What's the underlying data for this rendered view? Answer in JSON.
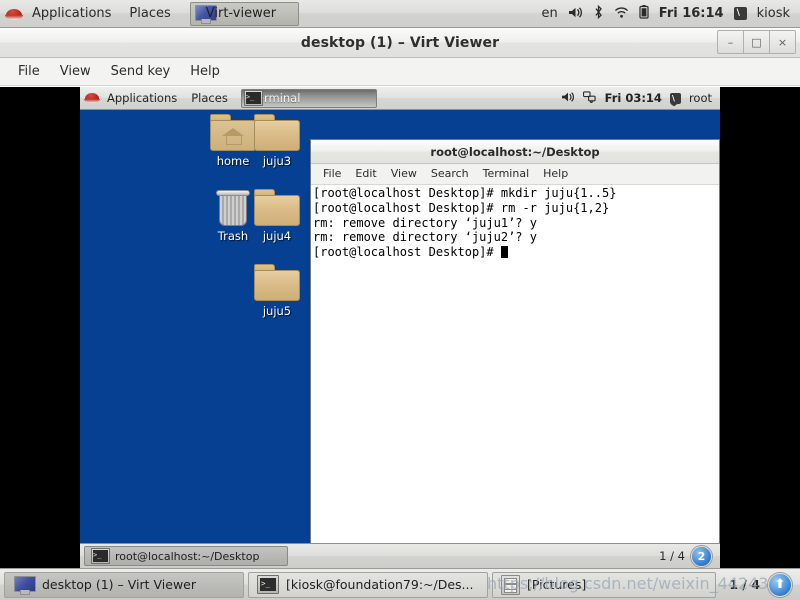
{
  "host_panel": {
    "logo_icon": "redhat-logo-icon",
    "menus": [
      "Applications",
      "Places"
    ],
    "task_chip": {
      "icon": "monitor-icon",
      "label": "Virt-viewer"
    },
    "tray": {
      "language": "en",
      "volume_icon": "speaker-icon",
      "bluetooth_icon": "bluetooth-icon",
      "wifi_icon": "wifi-icon",
      "battery_icon": "battery-icon",
      "clock": "Fri 16:14",
      "user_icon": "user-icon",
      "user": "kiosk"
    }
  },
  "virt_viewer": {
    "title": "desktop (1) – Virt Viewer",
    "window_buttons": {
      "minimize": "–",
      "maximize": "□",
      "close": "×"
    },
    "menus": [
      "File",
      "View",
      "Send key",
      "Help"
    ]
  },
  "vm": {
    "top_panel": {
      "logo_icon": "redhat-logo-icon",
      "menus": [
        "Applications",
        "Places"
      ],
      "task_chip": {
        "icon": "terminal-icon",
        "label": "Terminal"
      },
      "tray": {
        "volume_icon": "speaker-icon",
        "network_disconnected_icon": "network-offline-icon",
        "clock": "Fri 03:14",
        "user_icon": "user-icon",
        "user": "root"
      }
    },
    "desktop_icons": [
      {
        "name": "home",
        "label": "home",
        "icon": "home-folder-icon"
      },
      {
        "name": "trash",
        "label": "Trash",
        "icon": "trash-icon"
      },
      {
        "name": "juju3",
        "label": "juju3",
        "icon": "folder-icon"
      },
      {
        "name": "juju4",
        "label": "juju4",
        "icon": "folder-icon"
      },
      {
        "name": "juju5",
        "label": "juju5",
        "icon": "folder-icon"
      }
    ],
    "terminal": {
      "title": "root@localhost:~/Desktop",
      "menus": [
        "File",
        "Edit",
        "View",
        "Search",
        "Terminal",
        "Help"
      ],
      "lines": [
        "[root@localhost Desktop]# mkdir juju{1..5}",
        "[root@localhost Desktop]# rm -r juju{1,2}",
        "rm: remove directory ‘juju1’? y",
        "rm: remove directory ‘juju2’? y",
        "[root@localhost Desktop]# "
      ]
    },
    "bottom_panel": {
      "window_button": {
        "icon": "terminal-icon",
        "label": "root@localhost:~/Desktop"
      },
      "workspace_indicator": "1 / 4",
      "workspace_badge": "2"
    }
  },
  "host_taskbar": {
    "buttons": [
      {
        "icon": "monitor-icon",
        "label": "desktop (1) – Virt Viewer",
        "state": "active"
      },
      {
        "icon": "terminal-icon",
        "label": "[kiosk@foundation79:~/Des...",
        "state": "inactive"
      },
      {
        "icon": "files-icon",
        "label": "[Pictures]",
        "state": "inactive"
      }
    ],
    "workspace_indicator": "1 / 4",
    "workspace_badge": "⬆"
  },
  "watermark": {
    "text": "https://blog.csdn.net/weixin_44243"
  },
  "colors": {
    "desktop_blue": "#064092",
    "panel_grey": "#dededb",
    "terminal_bg": "#ffffff",
    "accent_blue": "#3480cf"
  }
}
